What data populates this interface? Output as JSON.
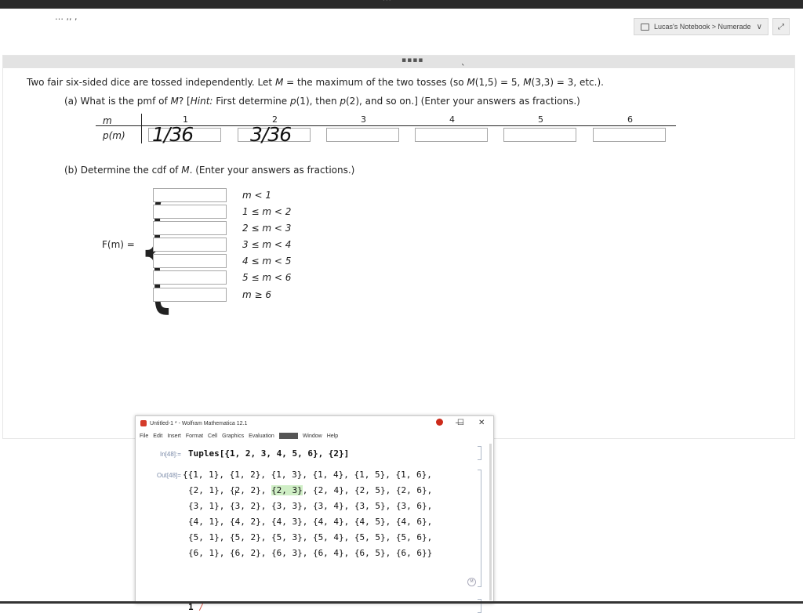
{
  "top": {
    "cutoff_text": "…   ,,           ,",
    "notebook_label": "Lucas's Notebook > Numerade",
    "chevron": "∨",
    "expand": "⤢"
  },
  "content": {
    "grip": "▪▪▪▪",
    "tick": "ˎ",
    "problem": {
      "pre": "Two fair six-sided dice are tossed independently. Let ",
      "M": "M",
      "mid1": " = the maximum of the two tosses (so ",
      "M2": "M",
      "mid2": "(1,5) = 5, ",
      "M3": "M",
      "end": "(3,3) = 3, etc.)."
    },
    "part_a": {
      "pre": "(a) What is the pmf of ",
      "M": "M",
      "mid": "? [",
      "hint": "Hint:",
      "mid2": " First determine ",
      "p1": "p",
      "mid3": "(1), then ",
      "p2": "p",
      "end": "(2), and so on.] (Enter your answers as fractions.)"
    },
    "part_b": {
      "pre": "(b) Determine the cdf of ",
      "M": "M",
      "end": ". (Enter your answers as fractions.)"
    },
    "pmf": {
      "m_label": "m",
      "p_label": "p(m)",
      "headers": [
        "1",
        "2",
        "3",
        "4",
        "5",
        "6"
      ],
      "handwritten": [
        "1/36",
        "3/36"
      ]
    },
    "cdf": {
      "label": "F(m) =",
      "conditions": [
        "m < 1",
        "1 ≤ m < 2",
        "2 ≤ m < 3",
        "3 ≤ m < 4",
        "4 ≤ m < 5",
        "5 ≤ m < 6",
        "m ≥ 6"
      ]
    }
  },
  "mathematica": {
    "title": "Untitled-1 * - Wolfram Mathematica 12.1",
    "controls": [
      "—",
      "☐",
      "✕"
    ],
    "menu": [
      "File",
      "Edit",
      "Insert",
      "Format",
      "Cell",
      "Graphics",
      "Evaluation",
      "Window",
      "Help"
    ],
    "in_label": "In[48]:=",
    "in_code": "Tuples[{1, 2, 3, 4, 5, 6}, {2}]",
    "out_label": "Out[48]=",
    "out_lines": [
      "{{1, 1}, {1, 2}, {1, 3}, {1, 4}, {1, 5}, {1, 6},",
      "{2, 1}, {2, 2}, ",
      "{3, 1}, {3, 2}, {3, 3}, {3, 4}, {3, 5}, {3, 6},",
      "{4, 1}, {4, 2}, {4, 3}, {4, 4}, {4, 5}, {4, 6},",
      "{5, 1}, {5, 2}, {5, 3}, {5, 4}, {5, 5}, {5, 6},",
      "{6, 1}, {6, 2}, {6, 3}, {6, 4}, {6, 5}, {6, 6}}"
    ],
    "highlight": "{2, 3}",
    "out_line2_tail": ", {2, 4}, {2, 5}, {2, 6},",
    "next_input": "1",
    "cursor": "/"
  },
  "colors": {
    "accent_logo": "#d43b2a",
    "highlight": "#cfeec5",
    "cell_bracket": "#aeb8c8"
  }
}
